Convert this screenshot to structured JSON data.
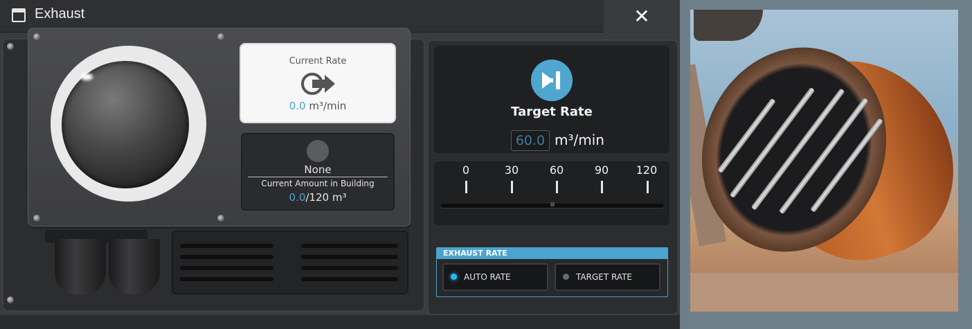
{
  "window": {
    "title": "Exhaust",
    "icon": "window-icon",
    "close_label": "✕"
  },
  "current_rate": {
    "label": "Current Rate",
    "icon": "flow-rate-icon",
    "value": "0.0",
    "unit": "m³/min"
  },
  "inventory": {
    "item_name": "None",
    "label": "Current Amount in Building",
    "amount": "0.0",
    "capacity": "/120 m³"
  },
  "target_rate": {
    "icon": "skip-forward-icon",
    "title": "Target Rate",
    "value": "60.0",
    "unit": "m³/min"
  },
  "slider": {
    "ticks": [
      "0",
      "30",
      "60",
      "90",
      "120"
    ],
    "min": 0,
    "max": 120,
    "value": 60
  },
  "exhaust_rate": {
    "title": "EXHAUST RATE",
    "options": [
      {
        "label": "AUTO RATE",
        "selected": true
      },
      {
        "label": "TARGET RATE",
        "selected": false
      }
    ]
  },
  "colors": {
    "accent": "#4aa4cf",
    "led_on": "#2ab8f0",
    "led_off": "#6a6a6a"
  }
}
